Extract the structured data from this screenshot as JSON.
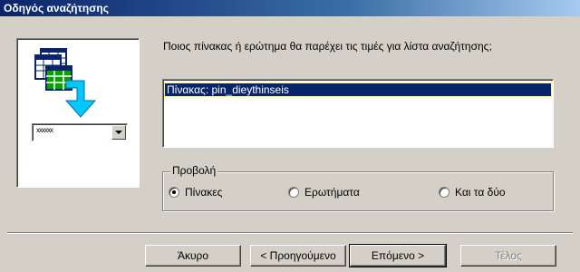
{
  "window": {
    "title": "Οδηγός αναζήτησης"
  },
  "illustration": {
    "combo_text": "xxxxxx",
    "icons": [
      "table-stack-icon",
      "down-arrow-icon"
    ]
  },
  "main": {
    "question": "Ποιος πίνακας ή ερώτημα θα παρέχει τις τιμές για λίστα αναζήτησης;",
    "list_items": [
      {
        "label": "Πίνακας: pin_dieythinseis",
        "selected": true
      }
    ]
  },
  "view_group": {
    "title": "Προβολή",
    "options": [
      {
        "label": "Πίνακες",
        "checked": true
      },
      {
        "label": "Ερωτήματα",
        "checked": false
      },
      {
        "label": "Και τα δύο",
        "checked": false
      }
    ]
  },
  "buttons": {
    "cancel": "Άκυρο",
    "back": "< Προηγούμενο",
    "next": "Επόμενο >",
    "finish": "Τέλος"
  }
}
